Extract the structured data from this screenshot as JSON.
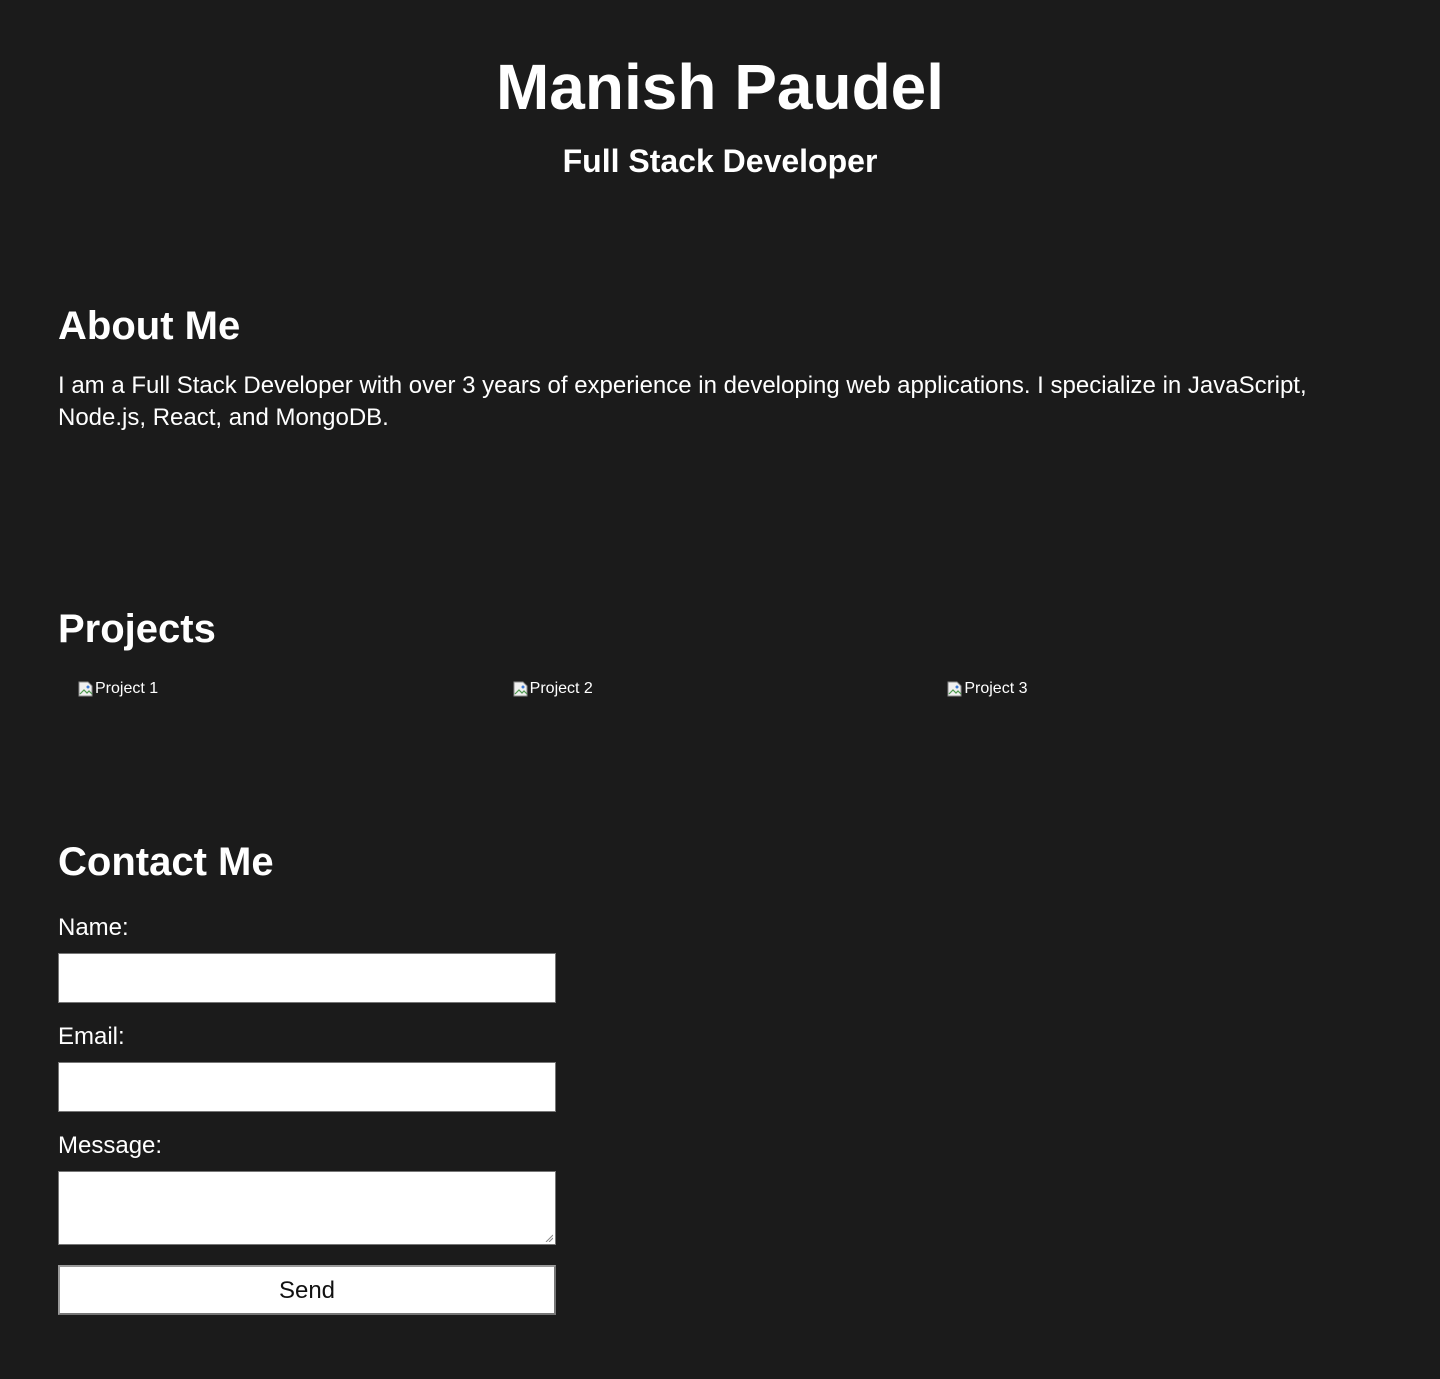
{
  "header": {
    "name": "Manish Paudel",
    "role": "Full Stack Developer"
  },
  "about": {
    "heading": "About Me",
    "text": "I am a Full Stack Developer with over 3 years of experience in developing web applications. I specialize in JavaScript, Node.js, React, and MongoDB."
  },
  "projects": {
    "heading": "Projects",
    "items": [
      {
        "alt": "Project 1",
        "icon": "broken-image-icon"
      },
      {
        "alt": "Project 2",
        "icon": "broken-image-icon"
      },
      {
        "alt": "Project 3",
        "icon": "broken-image-icon"
      }
    ]
  },
  "contact": {
    "heading": "Contact Me",
    "name_label": "Name:",
    "name_value": "",
    "email_label": "Email:",
    "email_value": "",
    "message_label": "Message:",
    "message_value": "",
    "send_label": "Send"
  },
  "colors": {
    "background": "#1b1b1b",
    "text": "#ffffff",
    "field_background": "#ffffff"
  }
}
